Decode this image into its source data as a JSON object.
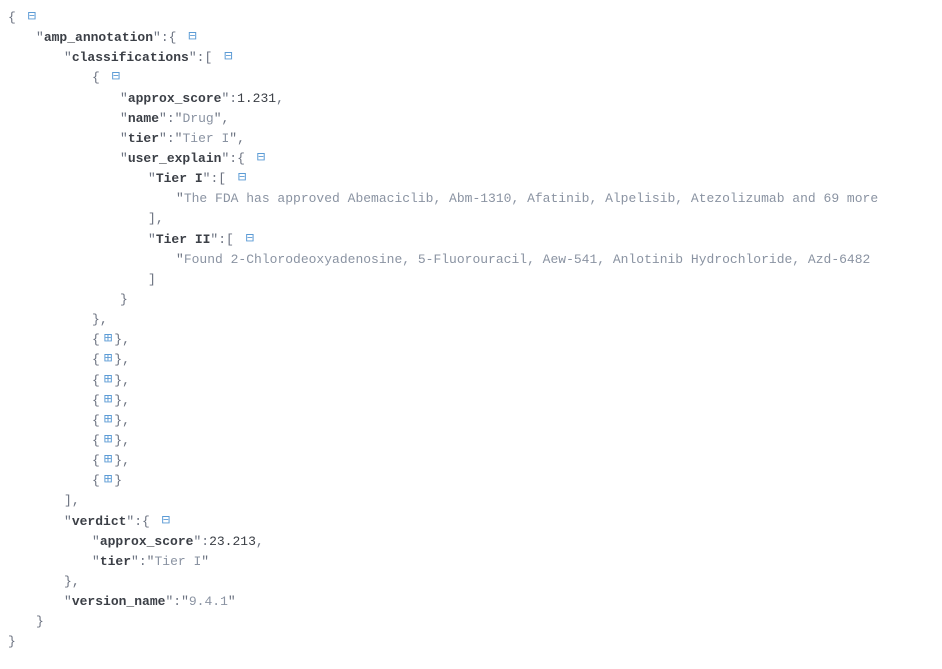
{
  "root": {
    "amp_annotation_key": "amp_annotation",
    "classifications_key": "classifications",
    "item0": {
      "approx_score_key": "approx_score",
      "approx_score_val": "1.231",
      "name_key": "name",
      "name_val": "Drug",
      "tier_key": "tier",
      "tier_val": "Tier I",
      "user_explain_key": "user_explain",
      "tier1_key": "Tier I",
      "tier1_text": "The FDA has approved Abemaciclib, Abm-1310, Afatinib, Alpelisib, Atezolizumab and 69 more",
      "tier2_key": "Tier II",
      "tier2_text": "Found 2-Chlorodeoxyadenosine, 5-Fluorouracil, Aew-541, Anlotinib Hydrochloride, Azd-6482"
    },
    "verdict_key": "verdict",
    "verdict": {
      "approx_score_key": "approx_score",
      "approx_score_val": "23.213",
      "tier_key": "tier",
      "tier_val": "Tier I"
    },
    "version_name_key": "version_name",
    "version_name_val": "9.4.1"
  }
}
